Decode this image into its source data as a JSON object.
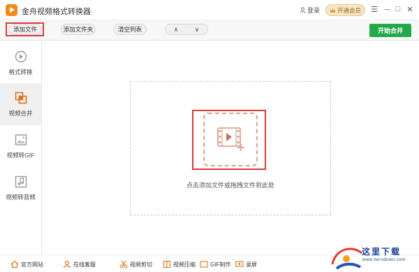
{
  "app": {
    "title": "金舟视频格式转换器",
    "login_label": "登录",
    "vip_label": "开通会员",
    "menu_glyph": "☰",
    "minimize_glyph": "—",
    "maximize_glyph": "□",
    "close_glyph": "✕"
  },
  "toolbar": {
    "add_file": "添加文件",
    "add_folder": "添加文件夹",
    "clear_list": "清空列表",
    "move_up": "∧",
    "move_down": "∨",
    "start_merge": "开始合并"
  },
  "sidebar": {
    "items": [
      {
        "label": "格式转换",
        "icon": "format-convert-icon",
        "active": false
      },
      {
        "label": "视频合并",
        "icon": "video-merge-icon",
        "active": true
      },
      {
        "label": "视频转GIF",
        "icon": "gif-icon",
        "active": false
      },
      {
        "label": "视频转音频",
        "icon": "audio-icon",
        "active": false
      }
    ]
  },
  "main": {
    "drop_text": "点击添加文件或拖拽文件到此处"
  },
  "footer": {
    "items": [
      {
        "label": "官方网站",
        "icon": "home-icon"
      },
      {
        "label": "在线客服",
        "icon": "support-icon"
      },
      {
        "label": "视频剪切",
        "icon": "cut-icon"
      },
      {
        "label": "视频压缩",
        "icon": "compress-icon"
      },
      {
        "label": "GIF制作",
        "icon": "gif-make-icon"
      },
      {
        "label": "录屏",
        "icon": "record-icon"
      }
    ]
  },
  "watermark": {
    "title": "这里下载",
    "url": "www.herodown.com"
  },
  "colors": {
    "accent": "#f08a1c",
    "merge_button": "#23a84a",
    "highlight": "#d93a3a",
    "vip_bg": "#f6e6c4"
  }
}
